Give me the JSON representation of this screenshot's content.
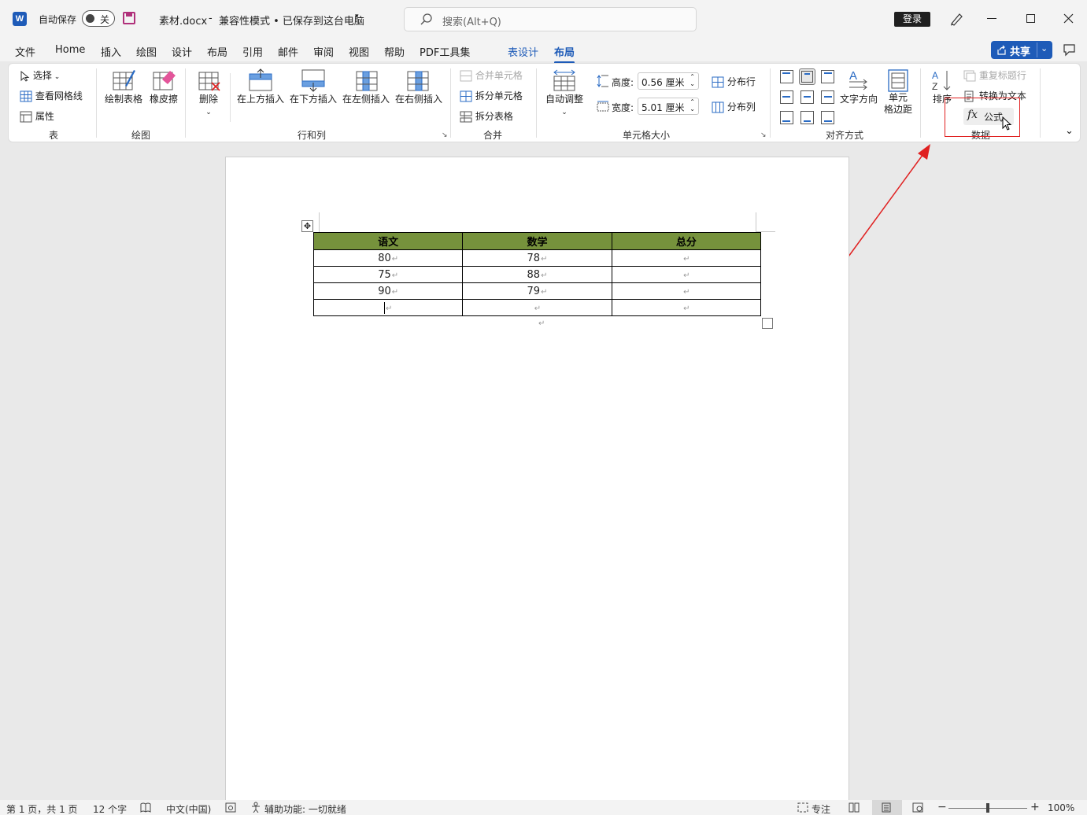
{
  "app": {
    "autosave_label": "自动保存",
    "autosave_state": "关",
    "filename": "素材.docx",
    "separator": "-",
    "mode_status": "兼容性模式 • 已保存到这台电脑",
    "search_placeholder": "搜索(Alt+Q)",
    "login_label": "登录",
    "share_label": "共享"
  },
  "tabs": [
    {
      "label": "文件"
    },
    {
      "label": "Home"
    },
    {
      "label": "插入"
    },
    {
      "label": "绘图"
    },
    {
      "label": "设计"
    },
    {
      "label": "布局"
    },
    {
      "label": "引用"
    },
    {
      "label": "邮件"
    },
    {
      "label": "审阅"
    },
    {
      "label": "视图"
    },
    {
      "label": "帮助"
    },
    {
      "label": "PDF工具集"
    },
    {
      "label": "表设计"
    },
    {
      "label": "布局"
    }
  ],
  "ribbon": {
    "table_group": {
      "select": "选择",
      "gridlines": "查看网格线",
      "properties": "属性",
      "label": "表"
    },
    "draw_group": {
      "draw_table": "绘制表格",
      "eraser": "橡皮擦",
      "label": "绘图"
    },
    "rows_group": {
      "delete": "删除",
      "insert_above": "在上方插入",
      "insert_below": "在下方插入",
      "insert_left": "在左侧插入",
      "insert_right": "在右侧插入",
      "label": "行和列"
    },
    "merge_group": {
      "merge_cells": "合并单元格",
      "split_cells": "拆分单元格",
      "split_table": "拆分表格",
      "label": "合并"
    },
    "size_group": {
      "autofit": "自动调整",
      "height_label": "高度:",
      "height_value": "0.56 厘米",
      "width_label": "宽度:",
      "width_value": "5.01 厘米",
      "distribute_rows": "分布行",
      "distribute_cols": "分布列",
      "label": "单元格大小"
    },
    "align_group": {
      "text_direction": "文字方向",
      "cell_margins_1": "单元",
      "cell_margins_2": "格边距",
      "label": "对齐方式"
    },
    "data_group": {
      "sort": "排序",
      "repeat_header": "重复标题行",
      "convert_text": "转换为文本",
      "formula": "公式",
      "formula_icon": "fx",
      "label": "数据"
    }
  },
  "document": {
    "table": {
      "headers": [
        "语文",
        "数学",
        "总分"
      ],
      "rows": [
        [
          "80",
          "78",
          ""
        ],
        [
          "75",
          "88",
          ""
        ],
        [
          "90",
          "79",
          ""
        ],
        [
          "",
          "",
          ""
        ]
      ]
    },
    "paragraph_mark": "↵"
  },
  "status": {
    "page": "第 1 页，共 1 页",
    "words": "12 个字",
    "language": "中文(中国)",
    "accessibility": "辅助功能: 一切就绪",
    "focus": "专注",
    "zoom": "100%"
  },
  "colors": {
    "table_header_bg": "#76923c",
    "accent_blue": "#1e5bb8",
    "annotation_red": "#e02020"
  }
}
